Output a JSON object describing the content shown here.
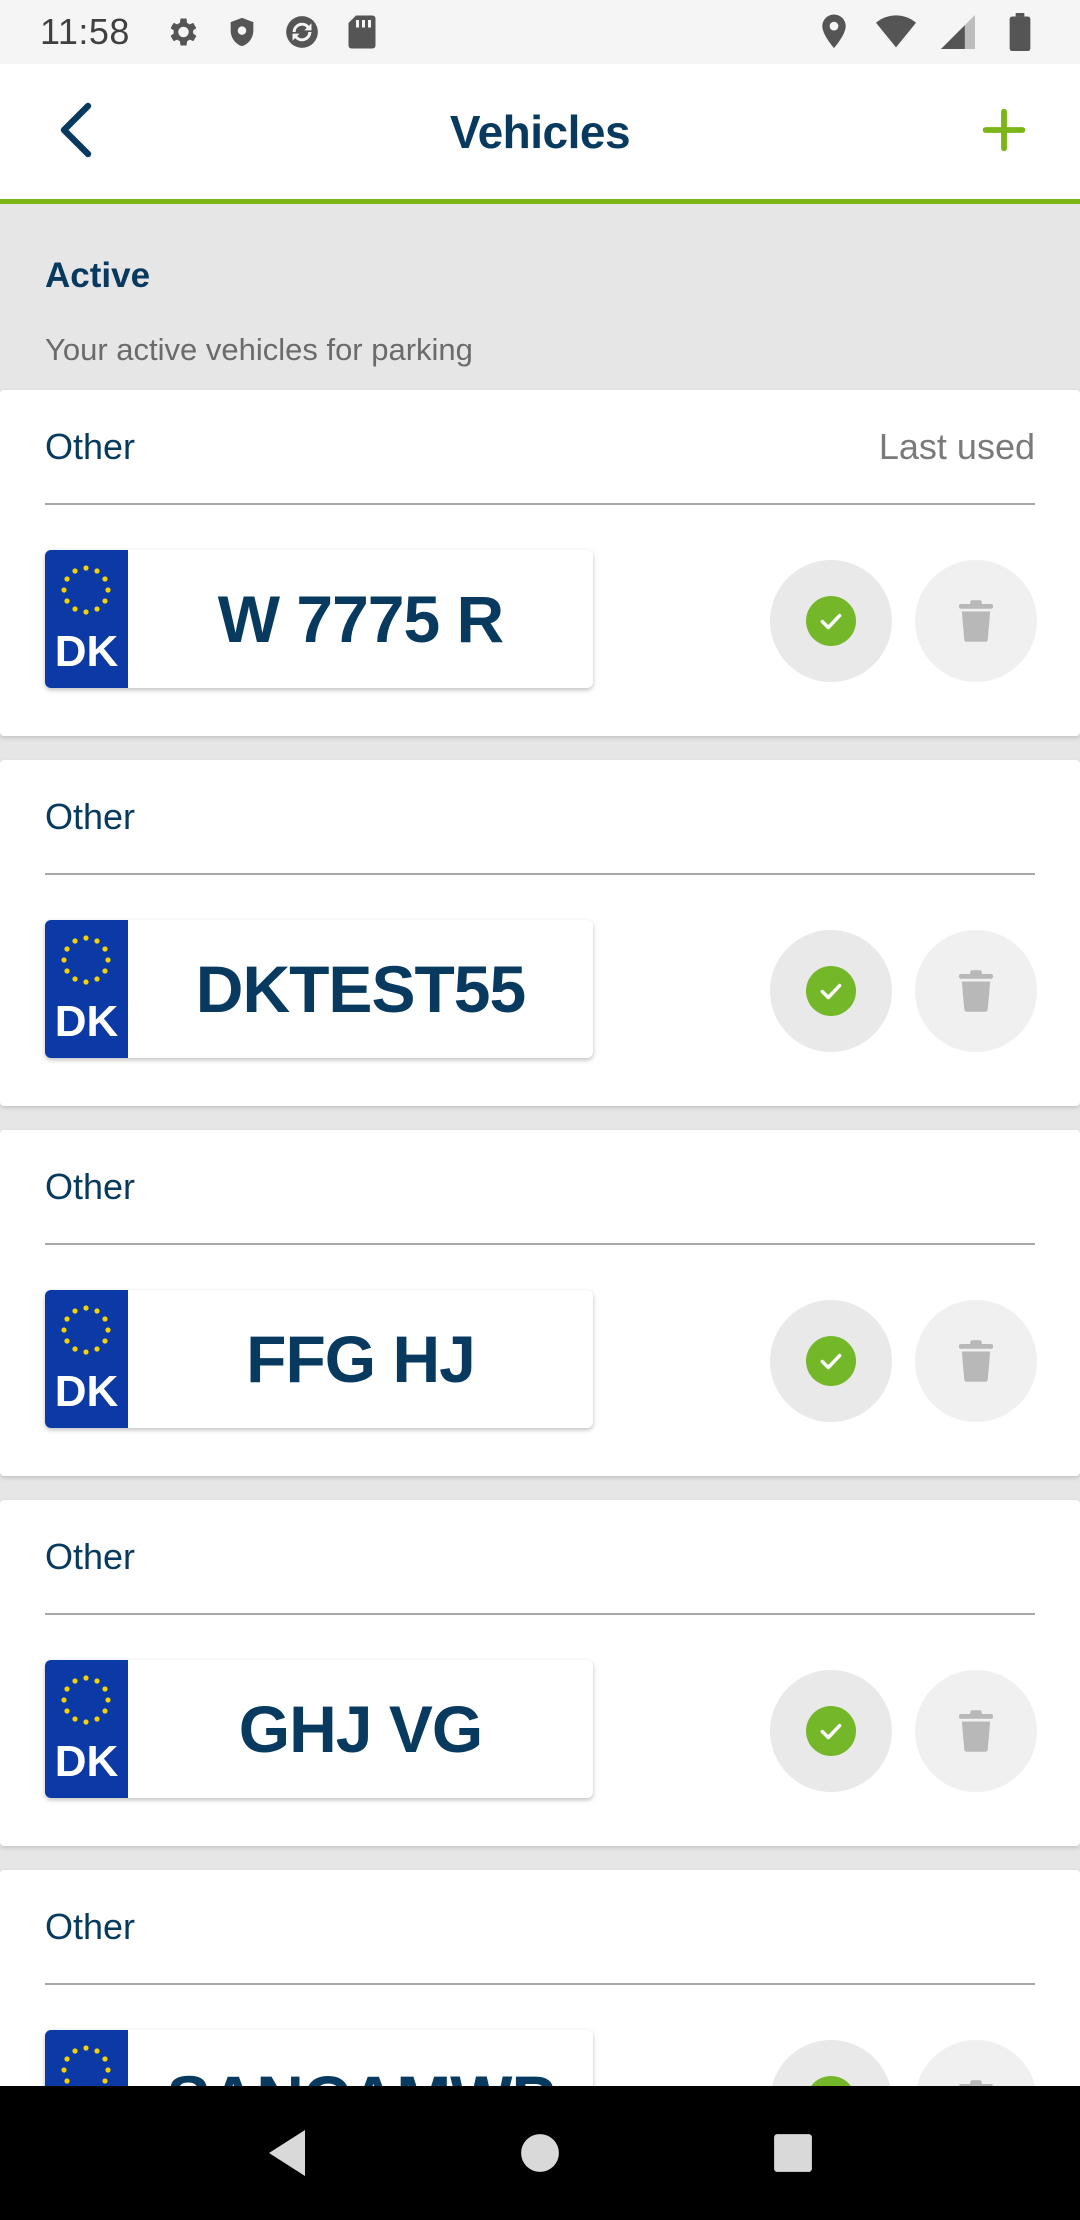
{
  "status_bar": {
    "time": "11:58",
    "left_icons": [
      "settings-icon",
      "shield-icon",
      "sync-icon",
      "sd-card-icon"
    ],
    "right_icons": [
      "location-icon",
      "wifi-icon",
      "signal-icon",
      "battery-icon"
    ]
  },
  "app_bar": {
    "title": "Vehicles",
    "back_icon": "chevron-left-icon",
    "add_icon": "plus-icon"
  },
  "section": {
    "heading": "Active",
    "subtitle": "Your active vehicles for parking"
  },
  "vehicles": [
    {
      "type": "Other",
      "badge": "Last used",
      "country": "DK",
      "plate": "W 7775 R"
    },
    {
      "type": "Other",
      "badge": "",
      "country": "DK",
      "plate": "DKTEST55"
    },
    {
      "type": "Other",
      "badge": "",
      "country": "DK",
      "plate": "FFG HJ"
    },
    {
      "type": "Other",
      "badge": "",
      "country": "DK",
      "plate": "GHJ VG"
    },
    {
      "type": "Other",
      "badge": "",
      "country": "DK",
      "plate": "SANCAMWP"
    }
  ],
  "colors": {
    "accent_green": "#7cb518",
    "navy": "#073a5e",
    "eu_blue": "#0b3aa6",
    "check_green": "#74b82a"
  },
  "nav_bar": {
    "icons": [
      "back-triangle-icon",
      "home-circle-icon",
      "recents-square-icon"
    ]
  }
}
